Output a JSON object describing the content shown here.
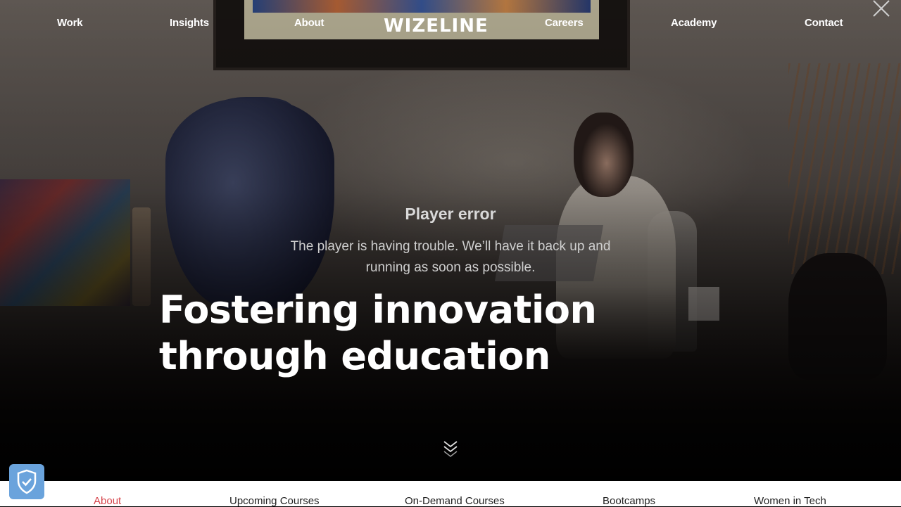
{
  "brand": {
    "logo_text": "WIZELINE"
  },
  "nav": {
    "items": [
      {
        "label": "Work"
      },
      {
        "label": "Insights"
      },
      {
        "label": "About"
      },
      {
        "label": "Careers"
      },
      {
        "label": "Academy"
      },
      {
        "label": "Contact"
      }
    ]
  },
  "player_error": {
    "title": "Player error",
    "message_line1": "The player is having trouble. We’ll have it back up and",
    "message_line2": "running as soon as possible."
  },
  "hero": {
    "headline_line1": "Fostering innovation",
    "headline_line2": "through education"
  },
  "subnav": {
    "items": [
      {
        "label": "About",
        "active": true
      },
      {
        "label": "Upcoming Courses",
        "active": false
      },
      {
        "label": "On-Demand Courses",
        "active": false
      },
      {
        "label": "Bootcamps",
        "active": false
      },
      {
        "label": "Women in Tech",
        "active": false
      }
    ]
  },
  "icons": {
    "close": "close-icon",
    "scroll": "double-chevron-down-icon",
    "privacy": "shield-check-icon"
  },
  "colors": {
    "accent": "#d6444b",
    "shield": "#6aa3dc"
  }
}
